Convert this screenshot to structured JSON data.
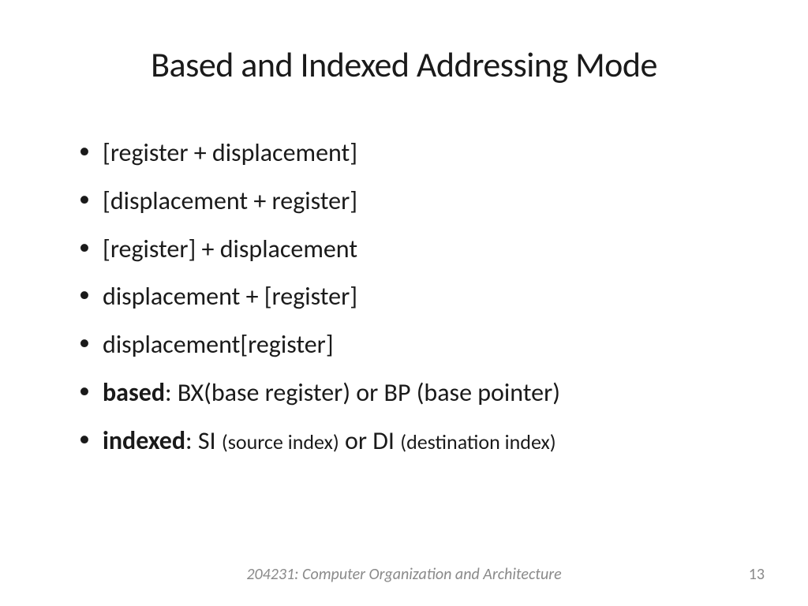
{
  "title": "Based and Indexed Addressing Mode",
  "bullets": [
    "[register + displacement]",
    "[displacement  + register]",
    "[register] + displacement",
    "displacement + [register]",
    "displacement[register]"
  ],
  "bullet6": {
    "bold": "based",
    "rest": ": BX(base register) or BP (base pointer)"
  },
  "bullet7": {
    "bold": "indexed",
    "part1": ": SI ",
    "small1": "(source index)",
    "part2": " or DI ",
    "small2": "(destination index)"
  },
  "footer": "204231: Computer Organization and Architecture",
  "page_number": "13"
}
